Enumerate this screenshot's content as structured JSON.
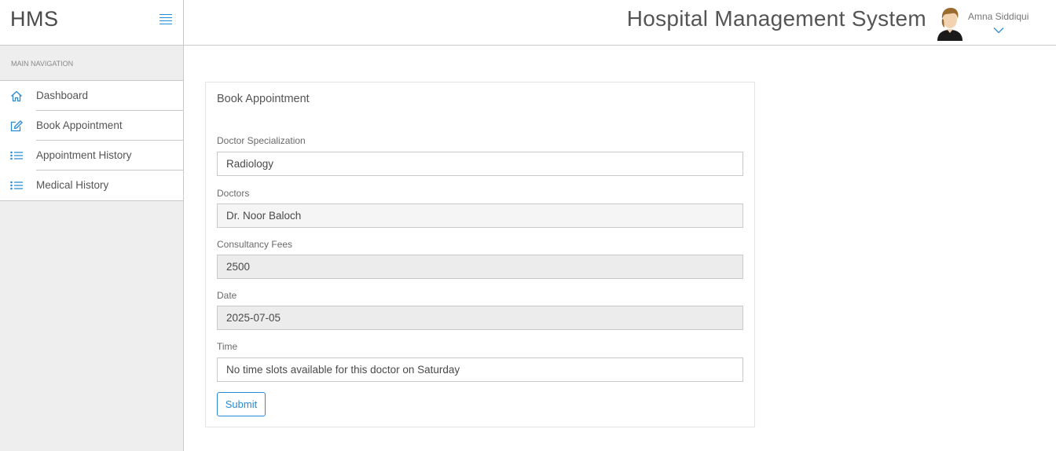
{
  "sidebar": {
    "brand": "HMS",
    "nav_header": "MAIN NAVIGATION",
    "items": [
      {
        "label": "Dashboard",
        "icon": "home-icon"
      },
      {
        "label": "Book Appointment",
        "icon": "edit-icon"
      },
      {
        "label": "Appointment History",
        "icon": "list-icon"
      },
      {
        "label": "Medical History",
        "icon": "list-icon"
      }
    ]
  },
  "header": {
    "title": "Hospital Management System",
    "user_name": "Amna Siddiqui"
  },
  "form": {
    "title": "Book Appointment",
    "specialization": {
      "label": "Doctor Specialization",
      "value": "Radiology"
    },
    "doctor": {
      "label": "Doctors",
      "value": "Dr. Noor Baloch"
    },
    "fees": {
      "label": "Consultancy Fees",
      "value": "2500"
    },
    "date": {
      "label": "Date",
      "value": "2025-07-05"
    },
    "time": {
      "label": "Time",
      "value": "No time slots available for this doctor on Saturday"
    },
    "submit_label": "Submit"
  },
  "colors": {
    "accent": "#2a8ad4",
    "sidebar_bg": "#eeeeef",
    "border": "#c9c9cc"
  }
}
